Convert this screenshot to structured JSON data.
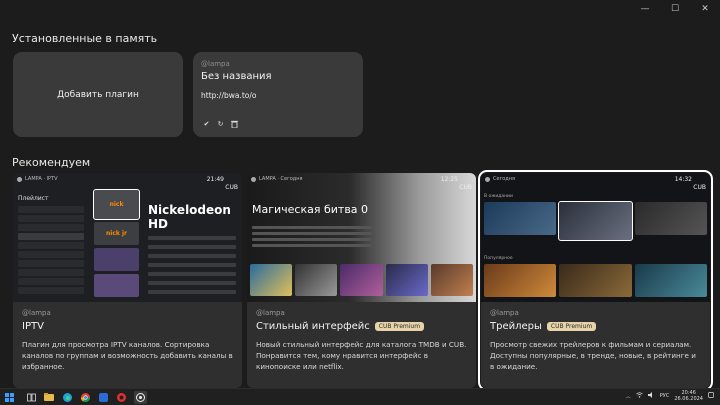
{
  "window": {
    "minimize": "—",
    "maximize": "☐",
    "close": "✕"
  },
  "installed_section": {
    "title": "Установленные в память",
    "add_plugin_label": "Добавить плагин",
    "plugin": {
      "author": "@lampa",
      "name": "Без названия",
      "url": "http://bwa.to/o"
    }
  },
  "recommend_section": {
    "title": "Рекомендуем",
    "cards": [
      {
        "author": "@lampa",
        "title": "IPTV",
        "badge": "",
        "description": "Плагин для просмотра IPTV каналов. Сортировка каналов по группам и возможность добавить каналы в избранное.",
        "preview": {
          "top": "LAMPA · IPTV",
          "clock": "21:49",
          "cub": "CUB",
          "list_header": "Плейлист",
          "channel_title": "Nickelodeon HD",
          "thumb_labels": [
            "nick",
            "nick jr",
            "",
            ""
          ]
        }
      },
      {
        "author": "@lampa",
        "title": "Стильный интерфейс",
        "badge": "CUB Premium",
        "description": "Новый стильный интерфейс для каталога TMDB и CUB. Понравится тем, кому нравится интерфейс в кинопоиске или netflix.",
        "preview": {
          "top": "LAMPA · Сегодня",
          "clock": "12:25",
          "cub": "CUB",
          "movie_title": "Магическая битва 0"
        }
      },
      {
        "author": "@lampa",
        "title": "Трейлеры",
        "badge": "CUB Premium",
        "description": "Просмотр свежих трейлеров к фильмам и сериалам. Доступны популярные, в тренде, новые, в рейтинге и в ожидание.",
        "preview": {
          "top": "Сегодня",
          "clock": "14:32",
          "cub": "CUB",
          "row1_label": "В ожидании",
          "row2_label": "Популярное"
        }
      }
    ]
  },
  "taskbar": {
    "language": "РУС",
    "time": "20:46",
    "date": "26.06.2024"
  }
}
